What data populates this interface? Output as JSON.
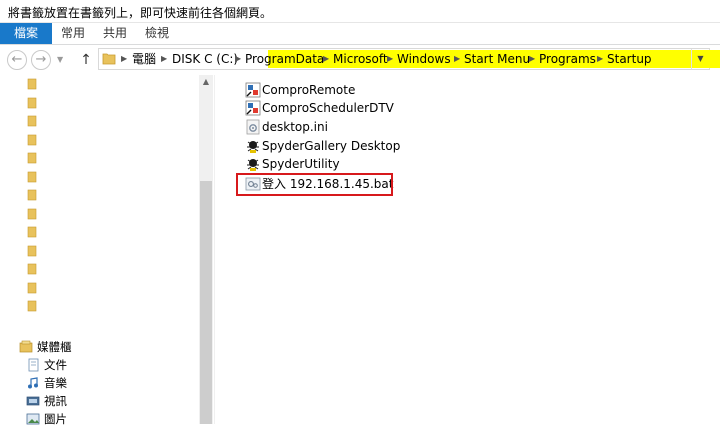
{
  "hint": "將書籤放置在書籤列上，即可快速前往各個網頁。",
  "ribbon": {
    "tabs": [
      "檔案",
      "常用",
      "共用",
      "檢視"
    ]
  },
  "address": {
    "crumbs": [
      "電腦",
      "DISK C (C:)",
      "ProgramData",
      "Microsoft",
      "Windows",
      "Start Menu",
      "Programs",
      "Startup"
    ],
    "highlight_color": "#ffff00"
  },
  "libraries": {
    "title": "媒體櫃",
    "items": [
      "文件",
      "音樂",
      "視訊",
      "圖片"
    ]
  },
  "files": [
    {
      "name": "ComproRemote",
      "icon": "app-shortcut-icon"
    },
    {
      "name": "ComproSchedulerDTV",
      "icon": "app-shortcut-icon"
    },
    {
      "name": "desktop.ini",
      "icon": "settings-file-icon"
    },
    {
      "name": "SpyderGallery Desktop",
      "icon": "spyder-shortcut-icon"
    },
    {
      "name": "SpyderUtility",
      "icon": "spyder-shortcut-icon"
    },
    {
      "name": "登入 192.168.1.45.bat",
      "icon": "batch-file-icon"
    }
  ],
  "colors": {
    "accent": "#1979ca",
    "annotation": "#d7191c",
    "folder": "#e8c25c"
  }
}
